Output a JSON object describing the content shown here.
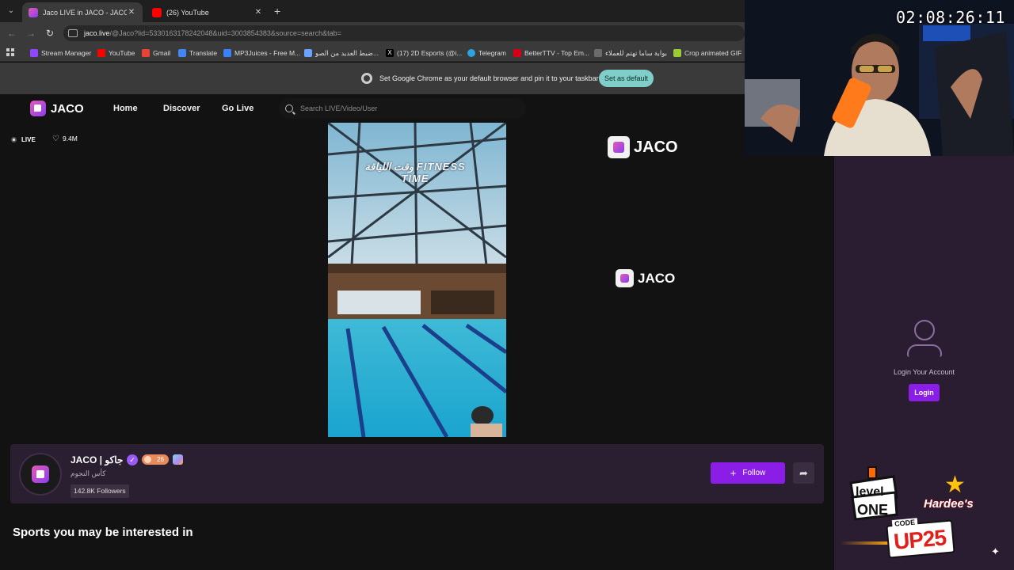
{
  "browser": {
    "tabs": [
      {
        "title": "Jaco LIVE in JACO - JACO",
        "active": true
      },
      {
        "title": "(26) YouTube",
        "active": false
      }
    ],
    "url_host": "jaco.live",
    "url_path": "/@Jaco?lid=5330163178242048&uid=3003854383&source=search&tab=",
    "bookmarks": [
      {
        "label": "Stream Manager",
        "icon": "stream-manager-icon",
        "color": "#9146ff"
      },
      {
        "label": "YouTube",
        "icon": "youtube-icon",
        "color": "#ff0000"
      },
      {
        "label": "Gmail",
        "icon": "gmail-icon",
        "color": "#ea4335"
      },
      {
        "label": "Translate",
        "icon": "translate-icon",
        "color": "#4285f4"
      },
      {
        "label": "MP3Juices - Free M...",
        "icon": "mp3juices-icon",
        "color": "#3b82f6"
      },
      {
        "label": "ضبط العديد من الصو...",
        "icon": "heart-shield-icon",
        "color": "#6aa3ff"
      },
      {
        "label": "(17) 2D Esports (@i...",
        "icon": "x-icon",
        "color": "#000000"
      },
      {
        "label": "Telegram",
        "icon": "telegram-icon",
        "color": "#2aa3df"
      },
      {
        "label": "BetterTTV - Top Em...",
        "icon": "betterttv-icon",
        "color": "#d50014"
      },
      {
        "label": "بوابة ساما تهتم للعملاء",
        "icon": "sama-icon",
        "color": "#6b6b6b"
      },
      {
        "label": "Crop animated GIF",
        "icon": "ezgif-icon",
        "color": "#9acd32"
      }
    ],
    "infobar_text": "Set Google Chrome as your default browser and pin it to your taskbar",
    "set_default_label": "Set as default"
  },
  "site": {
    "brand": "JACO",
    "nav": [
      "Home",
      "Discover",
      "Go Live"
    ],
    "search_placeholder": "Search LIVE/Video/User",
    "live_label": "LIVE",
    "likes": "9.4M",
    "video_overlay_text": "وقت اللياقة FITNESS TIME",
    "watermark": "JACO",
    "channel": {
      "name": "JACO | جاكو",
      "level": "26",
      "subtitle": "كأس النجوم",
      "followers": "142.8K Followers",
      "follow_label": "Follow"
    },
    "section_heading": "Sports you may be interested in"
  },
  "sidebar": {
    "login_prompt": "Login Your Account",
    "login_label": "Login"
  },
  "overlay": {
    "timer": "02:08:26:11",
    "sponsor_1": "level ONE",
    "sponsor_2": "Hardee's",
    "code_label": "CODE",
    "code_value": "UP25"
  },
  "colors": {
    "accent": "#8a1ee6",
    "sidebar_bg": "#2a1c31",
    "set_default_bg": "#7fcfc8"
  }
}
